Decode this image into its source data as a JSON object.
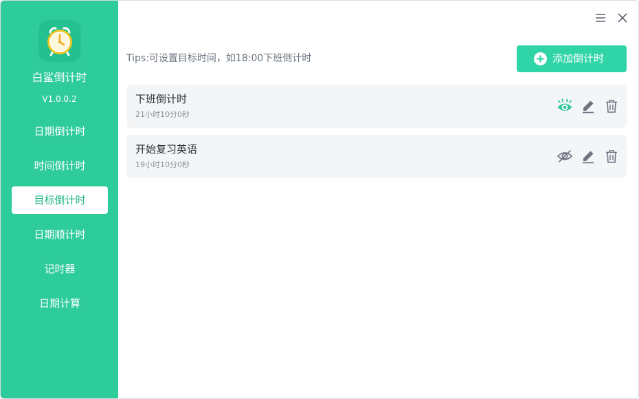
{
  "app": {
    "name": "白鲨倒计时",
    "version": "V1.0.0.2"
  },
  "sidebar": {
    "items": [
      {
        "label": "日期倒计时",
        "active": false
      },
      {
        "label": "时间倒计时",
        "active": false
      },
      {
        "label": "目标倒计时",
        "active": true
      },
      {
        "label": "日期顺计时",
        "active": false
      },
      {
        "label": "记时器",
        "active": false
      },
      {
        "label": "日期计算",
        "active": false
      }
    ]
  },
  "main": {
    "tips": "Tips:可设置目标时间，如18:00下班倒计时",
    "add_button": "添加倒计时",
    "countdowns": [
      {
        "title": "下班倒计时",
        "remaining": "21小时10分0秒",
        "visible": true
      },
      {
        "title": "开始复习英语",
        "remaining": "19小时10分0秒",
        "visible": false
      }
    ]
  },
  "icons": {
    "window": [
      "menu-icon",
      "close-icon"
    ],
    "card": [
      "eye-icon",
      "eye-off-icon",
      "edit-icon",
      "trash-icon"
    ],
    "add": "plus-circle-icon"
  },
  "colors": {
    "sidebar_bg": "#2ecb9b",
    "accent": "#2fd5a7",
    "active_text": "#22b487",
    "card_bg": "#f4f5f7",
    "visible_eye": "#2fc79b",
    "icon_gray": "#6e7480"
  }
}
